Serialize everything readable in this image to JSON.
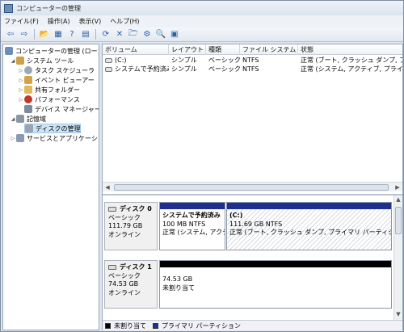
{
  "window": {
    "title": "コンピューターの管理"
  },
  "menu": [
    "ファイル(F)",
    "操作(A)",
    "表示(V)",
    "ヘルプ(H)"
  ],
  "toolbar": {
    "buttons": [
      "back-icon",
      "forward-icon",
      "up-folder-icon",
      "show-hide-tree-icon",
      "help-icon",
      "properties-icon",
      "refresh-icon",
      "delete-icon",
      "open-icon",
      "rescan-icon",
      "search-icon",
      "settings-icon"
    ],
    "glyphs": [
      "⇦",
      "⇨",
      "📂",
      "▦",
      "?",
      "▤",
      "⟳",
      "✕",
      "🗁",
      "⚙",
      "🔍",
      "▣"
    ]
  },
  "tree": {
    "root": "コンピューターの管理 (ローカ",
    "system_tools": "システム ツール",
    "task_scheduler": "タスク スケジューラ",
    "event_viewer": "イベント ビューアー",
    "shared_folders": "共有フォルダー",
    "performance": "パフォーマンス",
    "device_manager": "デバイス マネージャー",
    "storage": "記憶域",
    "disk_management": "ディスクの管理",
    "services": "サービスとアプリケーショ"
  },
  "volume_list": {
    "headers": [
      "ボリューム",
      "レイアウト",
      "種類",
      "ファイル システム",
      "状態"
    ],
    "rows": [
      [
        "(C:)",
        "シンプル",
        "ベーシック",
        "NTFS",
        "正常 (ブート, クラッシュ ダンプ, プラ"
      ],
      [
        "システムで予約済み",
        "シンプル",
        "ベーシック",
        "NTFS",
        "正常 (システム, アクティブ, プライマリ"
      ]
    ]
  },
  "disks": [
    {
      "name": "ディスク 0",
      "type": "ベーシック",
      "size": "111.79 GB",
      "status": "オンライン",
      "partitions": [
        {
          "name": "システムで予約済み",
          "detail": "100 MB NTFS",
          "status": "正常 (システム, アクテ"
        },
        {
          "name": "(C:)",
          "detail": "111.69 GB NTFS",
          "status": "正常 (ブート, クラッシュ ダンプ, プライマリ パーティショ"
        }
      ]
    },
    {
      "name": "ディスク 1",
      "type": "ベーシック",
      "size": "74.53 GB",
      "status": "オンライン",
      "partitions": [
        {
          "name": "74.53 GB",
          "detail": "未割り当て"
        }
      ]
    }
  ],
  "legend": {
    "unallocated": "未割り当て",
    "primary": "プライマリ パーティション"
  },
  "colors": {
    "primary": "#1f2f8f",
    "unallocated": "#000000"
  }
}
